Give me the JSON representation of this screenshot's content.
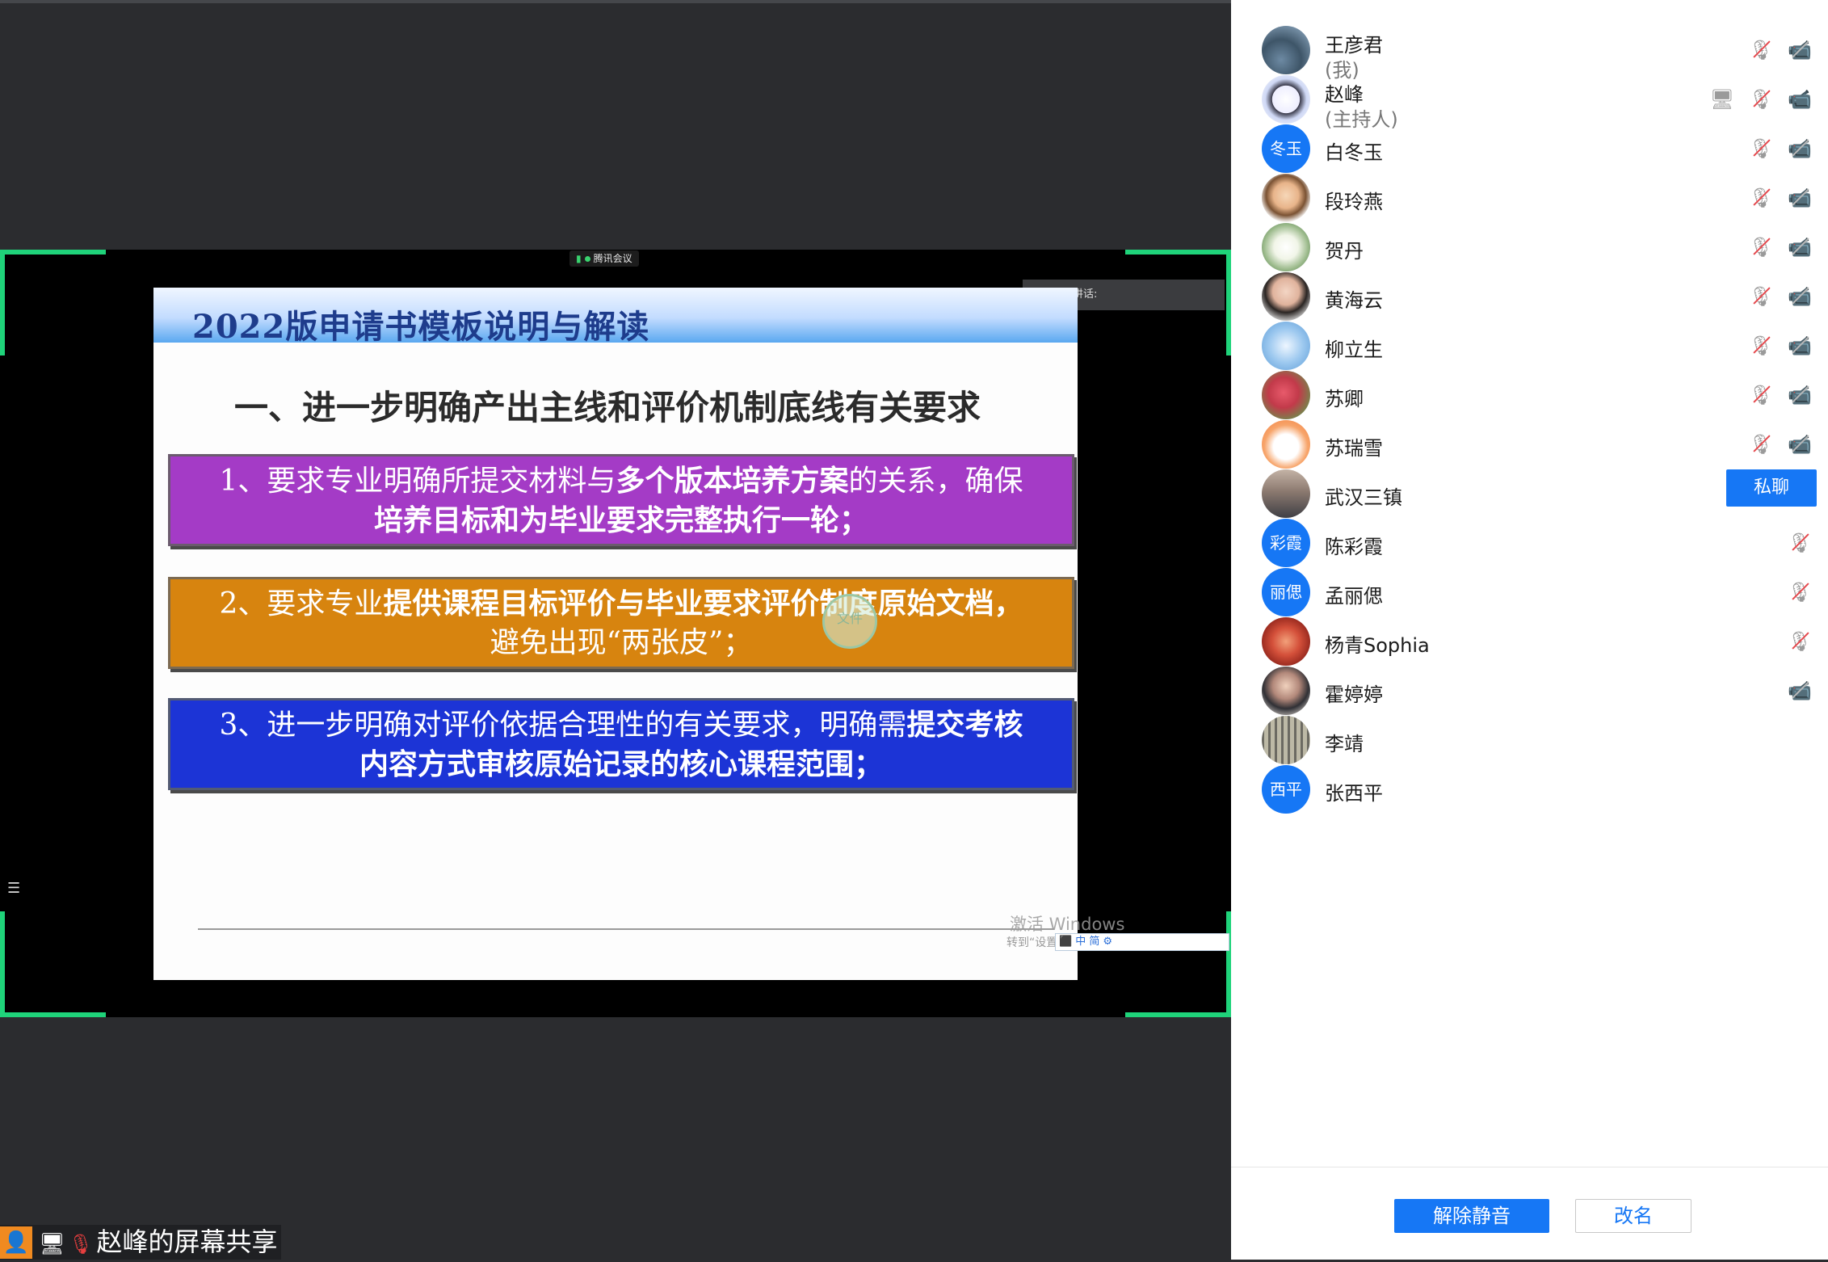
{
  "meeting": {
    "app_tag": "腾讯会议",
    "speaking_label": "正在讲话:",
    "share_banner": "赵峰的屏幕共享"
  },
  "slide": {
    "title": "2022版申请书模板说明与解读",
    "heading": "一、进一步明确产出主线和评价机制底线有关要求",
    "box1": {
      "line1_a": "1、要求专业明确所提交材料与",
      "line1_b": "多个版本培养方案",
      "line1_c": "的关系，确保",
      "line2": "培养目标和为毕业要求完整执行一轮；"
    },
    "box2": {
      "line1_a": "2、要求专业",
      "line1_b": "提供课程目标评价与毕业要求评价制度原始文档，",
      "line2": "避免出现“两张皮”；"
    },
    "box3": {
      "line1_a": "3、进一步明确对评价依据合理性的有关要求，明确需",
      "line1_b": "提交考核",
      "line2": "内容方式审核原始记录的核心课程范围；"
    },
    "seal_text": "文件",
    "activate_windows": "激活 Windows",
    "activate_hint": "转到“设置”以激活 Windows。",
    "ime_text": "中 简"
  },
  "participants": [
    {
      "name": "王彦君",
      "sub": "(我)",
      "avatar": "photo-city",
      "screen": false,
      "mic_muted": true,
      "video_off": true
    },
    {
      "name": "赵峰",
      "sub": "(主持人)",
      "avatar": "photo-cartoon",
      "screen": true,
      "mic_muted": true,
      "video_off": false
    },
    {
      "name": "白冬玉",
      "avatar_text": "冬玉",
      "mic_muted": true,
      "video_off": true
    },
    {
      "name": "段玲燕",
      "avatar": "photo-girl",
      "mic_muted": true,
      "video_off": true
    },
    {
      "name": "贺丹",
      "avatar": "photo-flower",
      "mic_muted": true,
      "video_off": true
    },
    {
      "name": "黄海云",
      "avatar": "photo-child",
      "mic_muted": true,
      "video_off": true
    },
    {
      "name": "柳立生",
      "avatar": "photo-sky",
      "mic_muted": true,
      "video_off": true
    },
    {
      "name": "苏卿",
      "avatar": "photo-red-flowers",
      "mic_muted": true,
      "video_off": true
    },
    {
      "name": "苏瑞雪",
      "avatar": "photo-cartoon-cat",
      "mic_muted": true,
      "video_off": true
    },
    {
      "name": "武汉三镇",
      "avatar": "photo-sunset",
      "private_chat": "私聊"
    },
    {
      "name": "陈彩霞",
      "avatar_text": "彩霞",
      "mic_muted": true
    },
    {
      "name": "孟丽偲",
      "avatar_text": "丽偲",
      "mic_muted": true
    },
    {
      "name": "杨青Sophia",
      "avatar": "photo-red-art",
      "mic_muted": true
    },
    {
      "name": "霍婷婷",
      "avatar": "photo-woman",
      "video_off": true
    },
    {
      "name": "李靖",
      "avatar": "photo-calligraphy"
    },
    {
      "name": "张西平",
      "avatar_text": "西平"
    }
  ],
  "actions": {
    "unmute": "解除静音",
    "rename": "改名"
  },
  "colors": {
    "accent": "#1677f5",
    "share_border": "#1fd37a",
    "muted_red": "#e5484d"
  }
}
